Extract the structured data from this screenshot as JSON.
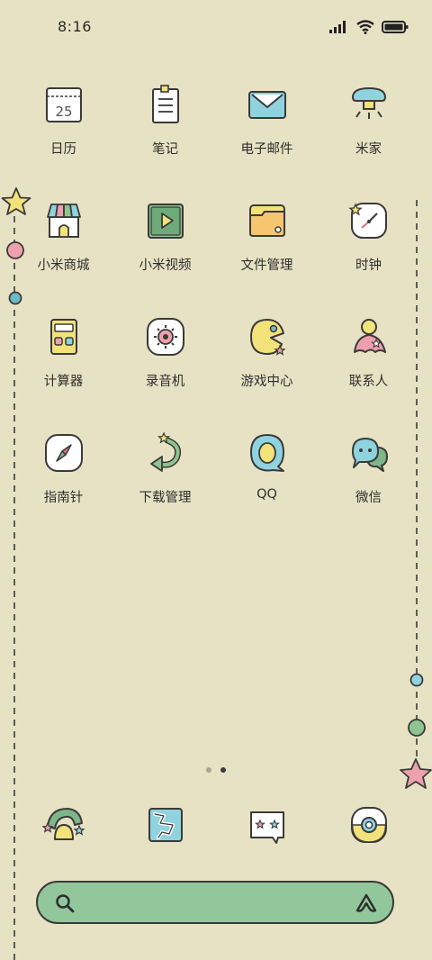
{
  "status_bar": {
    "time": "8:16"
  },
  "apps": [
    [
      {
        "label": "日历",
        "icon": "calendar-icon",
        "day": "25"
      },
      {
        "label": "笔记",
        "icon": "notes-icon"
      },
      {
        "label": "电子邮件",
        "icon": "email-icon"
      },
      {
        "label": "米家",
        "icon": "mijia-icon"
      }
    ],
    [
      {
        "label": "小米商城",
        "icon": "store-icon"
      },
      {
        "label": "小米视频",
        "icon": "video-icon"
      },
      {
        "label": "文件管理",
        "icon": "folder-icon"
      },
      {
        "label": "时钟",
        "icon": "clock-icon"
      }
    ],
    [
      {
        "label": "计算器",
        "icon": "calculator-icon"
      },
      {
        "label": "录音机",
        "icon": "recorder-icon"
      },
      {
        "label": "游戏中心",
        "icon": "game-center-icon"
      },
      {
        "label": "联系人",
        "icon": "contacts-icon"
      }
    ],
    [
      {
        "label": "指南针",
        "icon": "compass-icon"
      },
      {
        "label": "下载管理",
        "icon": "download-icon"
      },
      {
        "label": "QQ",
        "icon": "qq-icon"
      },
      {
        "label": "微信",
        "icon": "wechat-icon"
      }
    ]
  ],
  "page_indicator": {
    "pages": 2,
    "current": 2
  },
  "dock": [
    {
      "icon": "theme-icon"
    },
    {
      "icon": "gallery-icon"
    },
    {
      "icon": "messages-icon"
    },
    {
      "icon": "camera-icon"
    }
  ],
  "colors": {
    "background": "#e8e2c4",
    "search_bar": "#92c79b",
    "outline": "#3a3a3a",
    "blue": "#8fd3df",
    "yellow": "#f2e27a",
    "pink": "#eea0ad",
    "green": "#7fb58a"
  }
}
